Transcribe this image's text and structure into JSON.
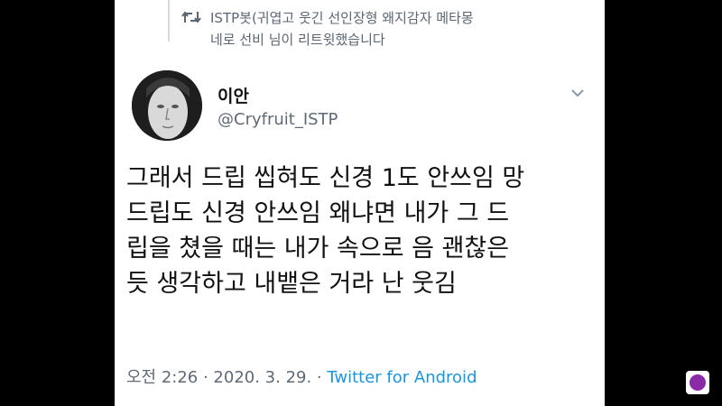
{
  "retweet": {
    "icon": "retweet-icon",
    "text": "ISTP봇(귀엽고 웃긴 선인장형 왜지감자 메타몽 네로 선비 님이 리트윗했습니다"
  },
  "tweet": {
    "author_name": "이안",
    "author_handle": "@Cryfruit_ISTP",
    "more_icon": "chevron-down-icon",
    "lines": [
      "그래서 드립 씹혀도 신경 1도 안쓰임 망",
      "드립도 신경 안쓰임 왜냐면 내가 그 드",
      "립을 쳤을 때는 내가 속으로 음 괜찮은",
      "듯 생각하고 내뱉은 거라 난 웃김"
    ],
    "timestamp": "오전 2:26 · 2020. 3. 29. · ",
    "source": "Twitter for Android"
  },
  "colors": {
    "background": "#000000",
    "card": "#ffffff",
    "link": "#1b95e0",
    "secondary_text": "#5f6a75"
  }
}
